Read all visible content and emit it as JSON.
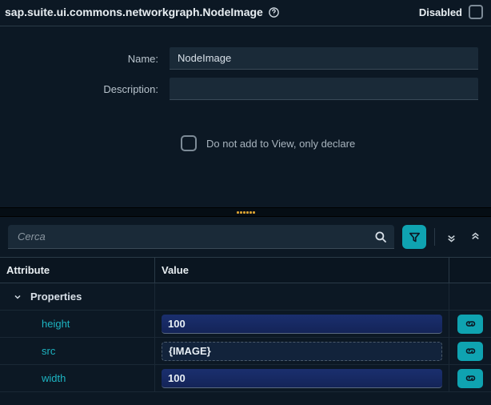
{
  "header": {
    "title": "sap.suite.ui.commons.networkgraph.NodeImage",
    "disabled_label": "Disabled",
    "disabled_checked": false
  },
  "form": {
    "name_label": "Name:",
    "name_value": "NodeImage",
    "description_label": "Description:",
    "description_value": "",
    "declare_label": "Do not add to View, only declare",
    "declare_checked": false
  },
  "toolbar": {
    "search_placeholder": "Cerca",
    "search_value": ""
  },
  "table": {
    "col_attribute": "Attribute",
    "col_value": "Value",
    "group": "Properties",
    "rows": [
      {
        "name": "height",
        "value": "100",
        "style": "solid"
      },
      {
        "name": "src",
        "value": "{IMAGE}",
        "style": "dashed"
      },
      {
        "name": "width",
        "value": "100",
        "style": "solid"
      }
    ]
  }
}
